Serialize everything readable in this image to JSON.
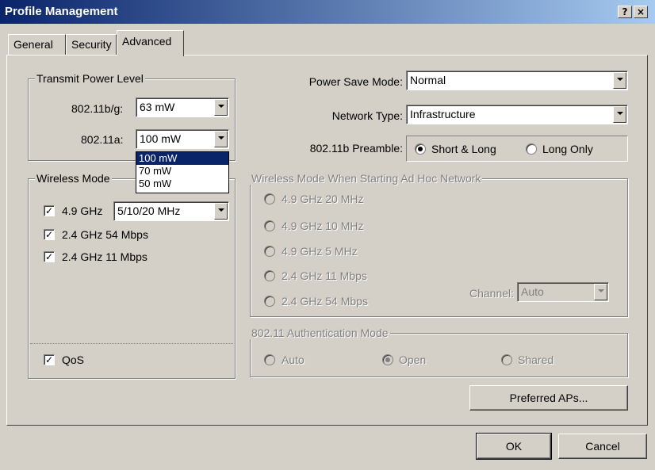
{
  "window": {
    "title": "Profile Management",
    "help_label": "?",
    "close_label": "×"
  },
  "tabs": [
    {
      "label": "General"
    },
    {
      "label": "Security"
    },
    {
      "label": "Advanced"
    }
  ],
  "transmit_power": {
    "legend": "Transmit Power Level",
    "b_g_label": "802.11b/g:",
    "b_g_value": "63 mW",
    "a_label": "802.11a:",
    "a_value": "100 mW",
    "a_options": [
      "100 mW",
      "70 mW",
      "50 mW"
    ]
  },
  "wireless_mode": {
    "legend": "Wireless Mode",
    "items": [
      {
        "label": "4.9 GHz",
        "checked": true
      },
      {
        "label": "2.4 GHz 54 Mbps",
        "checked": true
      },
      {
        "label": "2.4 GHz 11 Mbps",
        "checked": true
      }
    ],
    "ghz49_bandwidth": "5/10/20 MHz",
    "qos_label": "QoS",
    "qos_checked": true
  },
  "power_save": {
    "label": "Power Save Mode:",
    "value": "Normal"
  },
  "network_type": {
    "label": "Network Type:",
    "value": "Infrastructure"
  },
  "preamble": {
    "label": "802.11b Preamble:",
    "options": [
      {
        "label": "Short & Long",
        "selected": true
      },
      {
        "label": "Long Only",
        "selected": false
      }
    ]
  },
  "adhoc": {
    "legend": "Wireless Mode When Starting Ad Hoc Network",
    "options": [
      {
        "label": "4.9 GHz 20 MHz"
      },
      {
        "label": "4.9 GHz 10 MHz"
      },
      {
        "label": "4.9 GHz 5 MHz"
      },
      {
        "label": "2.4 GHz 11 Mbps"
      },
      {
        "label": "2.4 GHz 54 Mbps"
      }
    ],
    "channel_label": "Channel:",
    "channel_value": "Auto"
  },
  "auth": {
    "legend": "802.11 Authentication Mode",
    "options": [
      {
        "label": "Auto",
        "selected": false
      },
      {
        "label": "Open",
        "selected": true
      },
      {
        "label": "Shared",
        "selected": false
      }
    ]
  },
  "buttons": {
    "preferred_aps": "Preferred APs...",
    "ok": "OK",
    "cancel": "Cancel"
  },
  "colors": {
    "face": "#d4d0c8",
    "title_start": "#0a246a",
    "title_end": "#a6caf0",
    "selection": "#0a246a"
  }
}
